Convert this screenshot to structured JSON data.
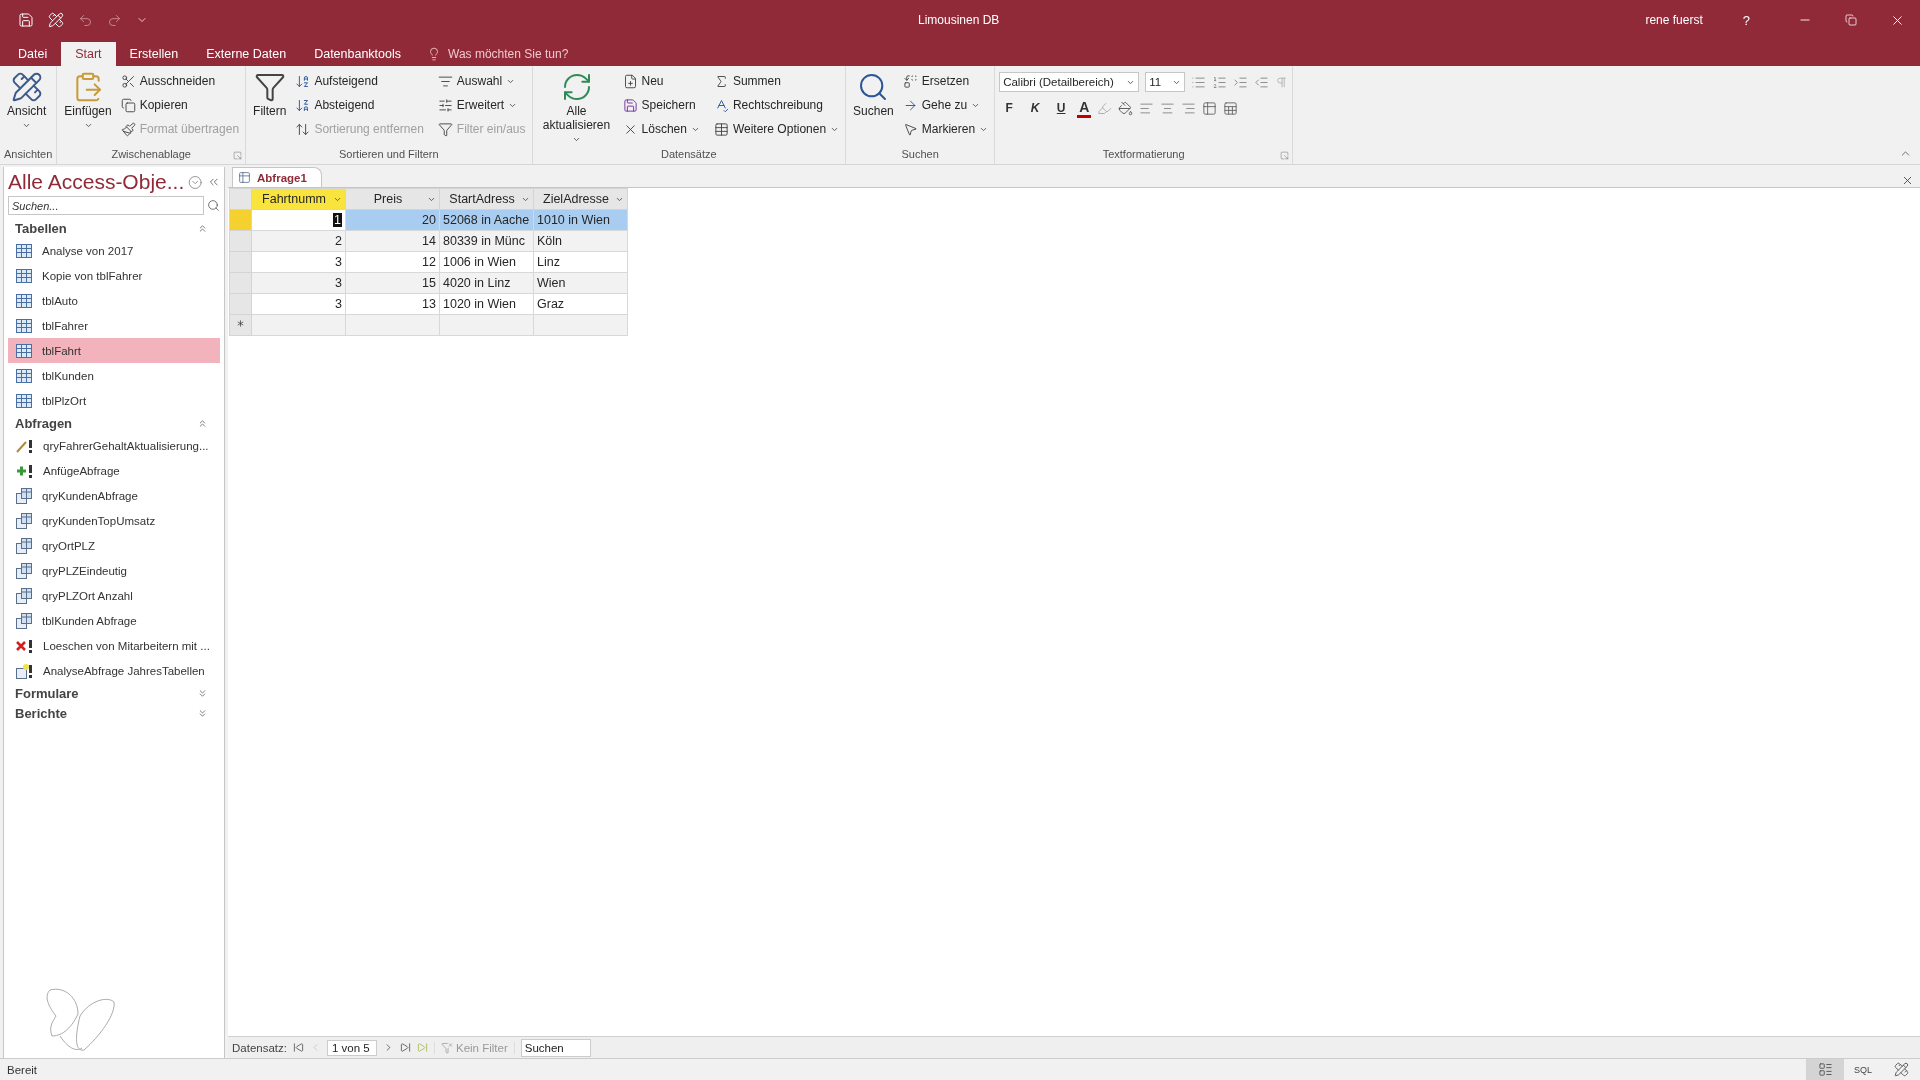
{
  "window": {
    "title": "Limousinen DB",
    "user": "rene fuerst",
    "help": "?"
  },
  "tabs": [
    {
      "label": "Datei",
      "selected": false
    },
    {
      "label": "Start",
      "selected": true
    },
    {
      "label": "Erstellen",
      "selected": false
    },
    {
      "label": "Externe Daten",
      "selected": false
    },
    {
      "label": "Datenbanktools",
      "selected": false
    }
  ],
  "tell_me": {
    "placeholder": "Was möchten Sie tun?"
  },
  "ribbon": {
    "groups": [
      {
        "label": "Ansichten",
        "launcher": false,
        "items": [
          {
            "kind": "large",
            "label": "Ansicht",
            "dropdown": true,
            "disabled": false
          }
        ]
      },
      {
        "label": "Zwischenablage",
        "launcher": true,
        "items": [
          {
            "kind": "large",
            "label": "Einfügen",
            "dropdown": true,
            "disabled": false
          },
          {
            "kind": "small",
            "label": "Ausschneiden",
            "dropdown": false,
            "disabled": false
          },
          {
            "kind": "small",
            "label": "Kopieren",
            "dropdown": false,
            "disabled": false
          },
          {
            "kind": "small",
            "label": "Format übertragen",
            "dropdown": false,
            "disabled": true
          }
        ]
      },
      {
        "label": "Sortieren und Filtern",
        "launcher": false,
        "items": [
          {
            "kind": "large",
            "label": "Filtern",
            "dropdown": false,
            "disabled": false
          },
          {
            "kind": "small",
            "label": "Aufsteigend",
            "dropdown": false,
            "disabled": false
          },
          {
            "kind": "small",
            "label": "Absteigend",
            "dropdown": false,
            "disabled": false
          },
          {
            "kind": "small",
            "label": "Sortierung entfernen",
            "dropdown": false,
            "disabled": true
          },
          {
            "kind": "small",
            "label": "Auswahl",
            "dropdown": true,
            "disabled": false
          },
          {
            "kind": "small",
            "label": "Erweitert",
            "dropdown": true,
            "disabled": false
          },
          {
            "kind": "small",
            "label": "Filter ein/aus",
            "dropdown": false,
            "disabled": true
          }
        ]
      },
      {
        "label": "Datensätze",
        "launcher": false,
        "items": [
          {
            "kind": "large",
            "label": "Alle aktualisieren",
            "dropdown": true,
            "disabled": false
          },
          {
            "kind": "small",
            "label": "Neu",
            "dropdown": false,
            "disabled": false
          },
          {
            "kind": "small",
            "label": "Speichern",
            "dropdown": false,
            "disabled": false
          },
          {
            "kind": "small",
            "label": "Löschen",
            "dropdown": true,
            "disabled": false
          },
          {
            "kind": "small",
            "label": "Summen",
            "dropdown": false,
            "disabled": false
          },
          {
            "kind": "small",
            "label": "Rechtschreibung",
            "dropdown": false,
            "disabled": false
          },
          {
            "kind": "small",
            "label": "Weitere Optionen",
            "dropdown": true,
            "disabled": false
          }
        ]
      },
      {
        "label": "Suchen",
        "launcher": false,
        "items": [
          {
            "kind": "large",
            "label": "Suchen",
            "dropdown": false,
            "disabled": false
          },
          {
            "kind": "small",
            "label": "Ersetzen",
            "dropdown": false,
            "disabled": false
          },
          {
            "kind": "small",
            "label": "Gehe zu",
            "dropdown": true,
            "disabled": false
          },
          {
            "kind": "small",
            "label": "Markieren",
            "dropdown": true,
            "disabled": false
          }
        ]
      }
    ],
    "text_format": {
      "label": "Textformatierung",
      "font": "Calibri (Detailbereich)",
      "size": "11",
      "styles": [
        "F",
        "K",
        "U"
      ],
      "font_color": {
        "label": "A",
        "color": "#c00000"
      }
    }
  },
  "navigation": {
    "title": "Alle Access-Obje...",
    "search": {
      "placeholder": "Suchen..."
    },
    "sections": [
      {
        "label": "Tabellen",
        "expanded": true,
        "items": [
          {
            "label": "Analyse von 2017",
            "kind": "table",
            "selected": false
          },
          {
            "label": "Kopie von tblFahrer",
            "kind": "table",
            "selected": false
          },
          {
            "label": "tblAuto",
            "kind": "table",
            "selected": false
          },
          {
            "label": "tblFahrer",
            "kind": "table",
            "selected": false
          },
          {
            "label": "tblFahrt",
            "kind": "table",
            "selected": true
          },
          {
            "label": "tblKunden",
            "kind": "table",
            "selected": false
          },
          {
            "label": "tblPlzOrt",
            "kind": "table",
            "selected": false
          }
        ]
      },
      {
        "label": "Abfragen",
        "expanded": true,
        "items": [
          {
            "label": "qryFahrerGehaltAktualisierung...",
            "kind": "update",
            "selected": false
          },
          {
            "label": "AnfügeAbfrage",
            "kind": "append",
            "selected": false
          },
          {
            "label": "qryKundenAbfrage",
            "kind": "select",
            "selected": false
          },
          {
            "label": "qryKundenTopUmsatz",
            "kind": "select",
            "selected": false
          },
          {
            "label": "qryOrtPLZ",
            "kind": "select",
            "selected": false
          },
          {
            "label": "qryPLZEindeutig",
            "kind": "select",
            "selected": false
          },
          {
            "label": "qryPLZOrt Anzahl",
            "kind": "select",
            "selected": false
          },
          {
            "label": "tblKunden Abfrage",
            "kind": "select",
            "selected": false
          },
          {
            "label": "Loeschen von Mitarbeitern mit ...",
            "kind": "delete",
            "selected": false
          },
          {
            "label": "AnalyseAbfrage JahresTabellen",
            "kind": "make_table",
            "selected": false
          }
        ]
      },
      {
        "label": "Formulare",
        "expanded": false
      },
      {
        "label": "Berichte",
        "expanded": false
      }
    ]
  },
  "document_tab": {
    "label": "Abfrage1"
  },
  "datasheet": {
    "columns": [
      {
        "label": "Fahrtnumm",
        "kind": "number",
        "selected": true
      },
      {
        "label": "Preis",
        "kind": "number",
        "selected": false
      },
      {
        "label": "StartAdress",
        "kind": "text",
        "selected": false
      },
      {
        "label": "ZielAdresse",
        "kind": "text",
        "selected": false
      }
    ],
    "rows": [
      {
        "cells": [
          "1",
          "20",
          "52068 in Aache",
          "1010 in Wien"
        ],
        "selected": true
      },
      {
        "cells": [
          "2",
          "14",
          "80339 in Münc",
          "Köln"
        ],
        "selected": false
      },
      {
        "cells": [
          "3",
          "12",
          "1006 in Wien",
          "Linz"
        ],
        "selected": false
      },
      {
        "cells": [
          "3",
          "15",
          "4020 in Linz",
          "Wien"
        ],
        "selected": false
      },
      {
        "cells": [
          "3",
          "13",
          "1020 in Wien",
          "Graz"
        ],
        "selected": false
      }
    ]
  },
  "record_nav": {
    "label": "Datensatz:",
    "position": "1 von 5",
    "filter": "Kein Filter",
    "search": {
      "placeholder": "Suchen"
    }
  },
  "status_bar": {
    "text": "Bereit",
    "views": [
      {
        "kind": "datasheet",
        "selected": true
      },
      {
        "kind": "sql",
        "label": "SQL",
        "selected": false
      },
      {
        "kind": "design",
        "selected": false
      }
    ]
  }
}
